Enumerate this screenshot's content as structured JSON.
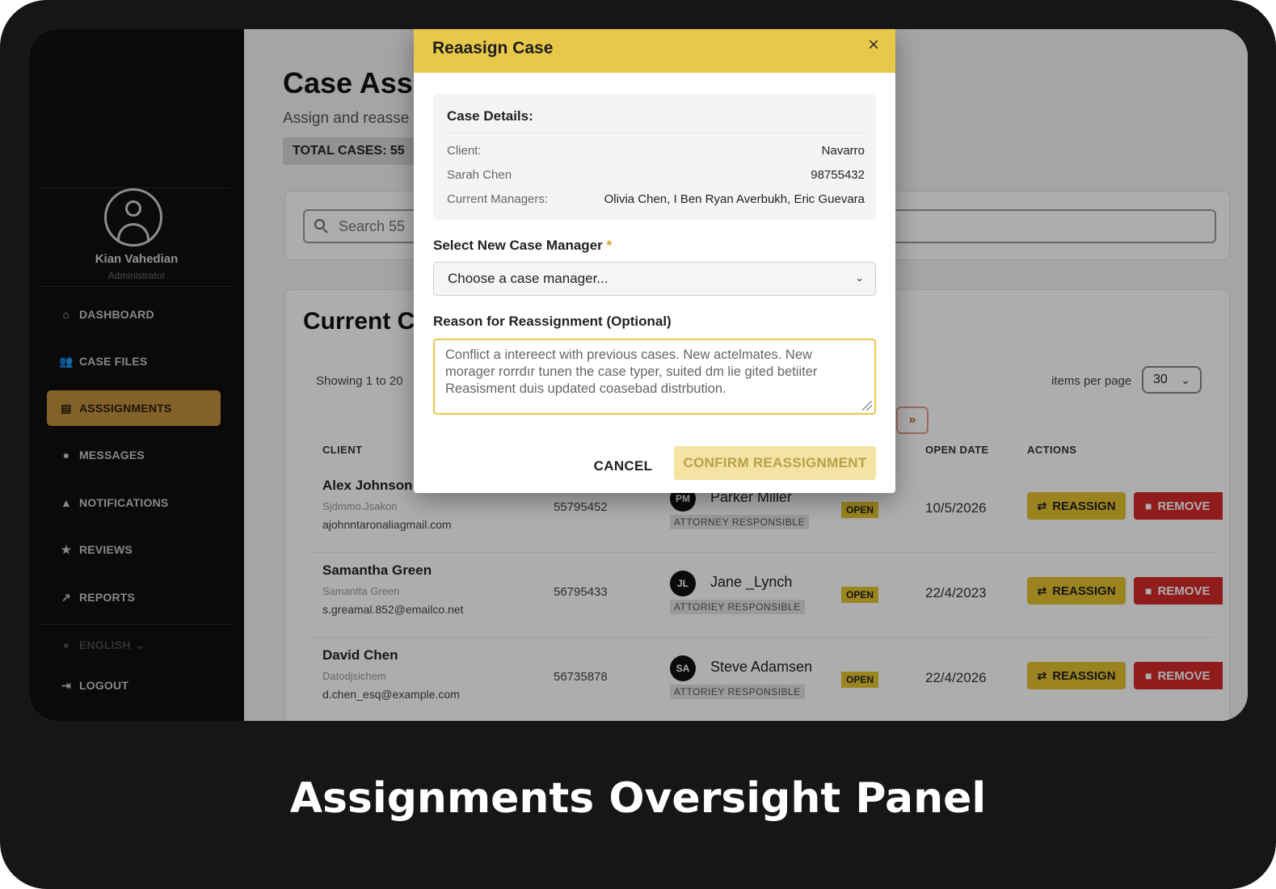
{
  "caption": "Assignments Oversight Panel",
  "sidebar": {
    "user_name": "Kian Vahedian",
    "user_role": "Administrator",
    "items": [
      {
        "label": "DASHBOARD",
        "icon": "home-icon"
      },
      {
        "label": "CASE FILES",
        "icon": "users-icon"
      },
      {
        "label": "ASSSIGNMENTS",
        "icon": "clipboard-icon"
      },
      {
        "label": "MESSAGES",
        "icon": "chat-icon"
      },
      {
        "label": "NOTIFICATIONS",
        "icon": "bell-icon"
      },
      {
        "label": "REVIEWS",
        "icon": "star-icon"
      },
      {
        "label": "REPORTS",
        "icon": "chart-icon"
      }
    ],
    "language": "ENGLISH",
    "logout": "LOGOUT"
  },
  "main": {
    "title": "Case Ass",
    "subtitle": "Assign and reasse",
    "total_cases": "TOTAL CASES: 55",
    "search_placeholder": "Search 55",
    "cases_title": "Current C",
    "showing": "Showing 1 to 20",
    "items_per_page_label": "items per page",
    "items_per_page_value": "30",
    "next_label": "»",
    "columns": {
      "client": "CLIENT",
      "open_date": "OPEN DATE",
      "actions": "ACTIONS"
    },
    "rows": [
      {
        "name": "Alex Johnson",
        "alt": "Sjdmmo.Jsakon",
        "email": "ajohnntaronaliagmail.com",
        "case_number": "55795452",
        "manager_initials": "PM",
        "manager": "Parker Miller",
        "manager_role": "ATTORNEY RESPONSIBLE",
        "status": "OPEN",
        "open_date": "10/5/2026"
      },
      {
        "name": "Samantha Green",
        "alt": "Samantta Green",
        "email": "s.greamal.852@emailco.net",
        "case_number": "56795433",
        "manager_initials": "JL",
        "manager": "Jane _Lynch",
        "manager_role": "ATTORIEY RESPONSIBLE",
        "status": "OPEN",
        "open_date": "22/4/2023"
      },
      {
        "name": "David Chen",
        "alt": "Datodjsichem",
        "email": "d.chen_esq@example.com",
        "case_number": "56735878",
        "manager_initials": "SA",
        "manager": "Steve Adamsen",
        "manager_role": "ATTORIEY RESPONSIBLE",
        "status": "OPEN",
        "open_date": "22/4/2026"
      }
    ],
    "reassign_label": "REASSIGN",
    "remove_label": "REMOVE"
  },
  "modal": {
    "title": "Reaasign Case",
    "close": "×",
    "details_title": "Case Details:",
    "details": [
      {
        "label": "Client:",
        "value": "Navarro"
      },
      {
        "label": "Sarah Chen",
        "value": "98755432"
      },
      {
        "label": "Current Managers:",
        "value": "Olivia Chen, I  Ben Ryan Averbukh, Eric Guevara"
      }
    ],
    "select_label": "Select New Case Manager",
    "required_mark": "*",
    "select_placeholder": "Choose a case manager...",
    "reason_label": "Reason for Reassignment (Optional)",
    "reason_text": "Conflict a intereect with previous cases. New actelmates. New morager rorrdır tunen the case typer, suited dm lie gited betiiter Reasisment duis updated coasebad distrbution.",
    "cancel": "CANCEL",
    "confirm": "CONFIRM REASSIGNMENT"
  },
  "colors": {
    "accent": "#e8c84b",
    "active_nav": "#c2913f",
    "danger": "#d42a2a"
  }
}
